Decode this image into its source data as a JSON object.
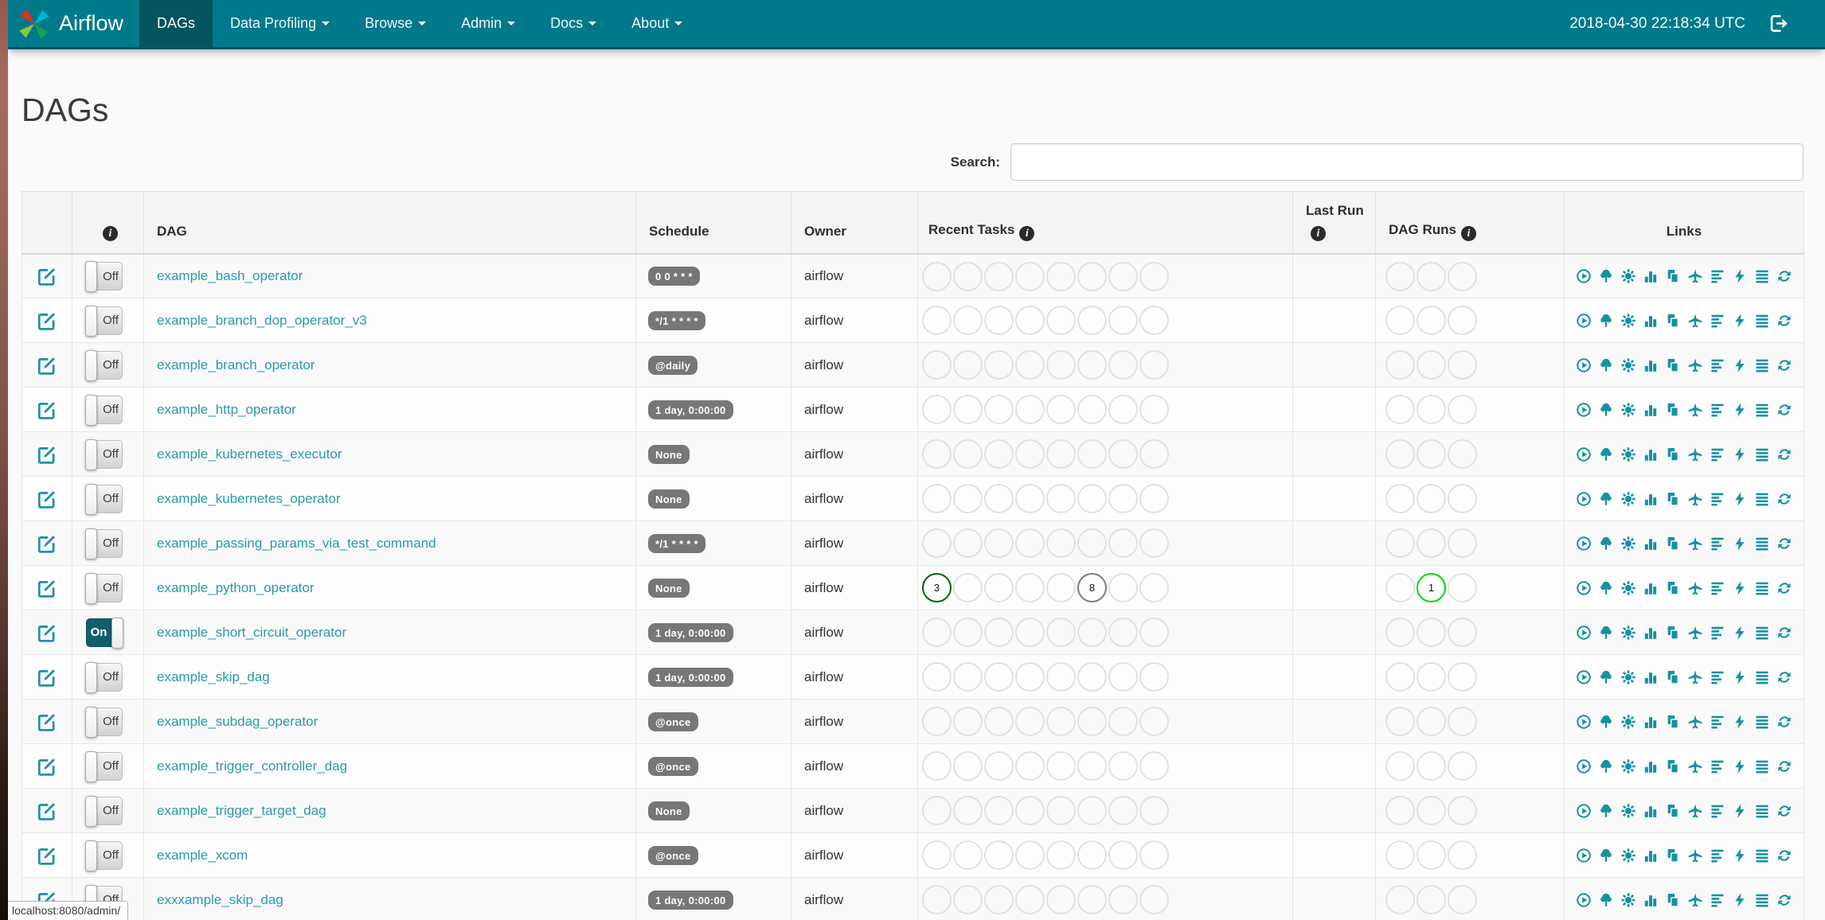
{
  "colors": {
    "navbar": "#00798a",
    "navbar_active": "#03545e",
    "link": "#2c9aa7",
    "icon": "#1691a3",
    "badge_bg": "#777777",
    "state_success": "#006400",
    "state_running": "#00d800",
    "state_queued": "#7d7d7d",
    "state_empty": "#e2e2e2"
  },
  "navbar": {
    "brand": "Airflow",
    "items": [
      {
        "label": "DAGs",
        "active": true
      },
      {
        "label": "Data Profiling"
      },
      {
        "label": "Browse"
      },
      {
        "label": "Admin"
      },
      {
        "label": "Docs"
      },
      {
        "label": "About"
      }
    ],
    "clock": "2018-04-30 22:18:34 UTC"
  },
  "page": {
    "title": "DAGs"
  },
  "search": {
    "label": "Search:",
    "value": "",
    "placeholder": ""
  },
  "table": {
    "headers": [
      {
        "label": ""
      },
      {
        "label": "",
        "info": true
      },
      {
        "label": "DAG"
      },
      {
        "label": "Schedule"
      },
      {
        "label": "Owner"
      },
      {
        "label": "Recent Tasks",
        "info": true
      },
      {
        "label": "Last Run",
        "info": true
      },
      {
        "label": "DAG Runs",
        "info": true
      },
      {
        "label": "Links"
      }
    ],
    "recent_task_circle_count": 8,
    "dag_run_circle_count": 3
  },
  "toggle": {
    "on_label": "On",
    "off_label": "Off"
  },
  "links": [
    "Trigger Dag",
    "Tree View",
    "Graph View",
    "Task Duration",
    "Task Tries",
    "Landing Times",
    "Gantt View",
    "Code View",
    "Logs",
    "Refresh"
  ],
  "link_icons": [
    "play-circle-icon",
    "tree-icon",
    "graph-icon",
    "duration-chart-icon",
    "task-tries-icon",
    "landing-times-icon",
    "gantt-icon",
    "code-bolt-icon",
    "logs-icon",
    "refresh-icon"
  ],
  "rows": [
    {
      "dag": "example_bash_operator",
      "toggle": "off",
      "schedule": "0 0 * * *",
      "owner": "airflow"
    },
    {
      "dag": "example_branch_dop_operator_v3",
      "toggle": "off",
      "schedule": "*/1 * * * *",
      "owner": "airflow"
    },
    {
      "dag": "example_branch_operator",
      "toggle": "off",
      "schedule": "@daily",
      "owner": "airflow"
    },
    {
      "dag": "example_http_operator",
      "toggle": "off",
      "schedule": "1 day, 0:00:00",
      "owner": "airflow"
    },
    {
      "dag": "example_kubernetes_executor",
      "toggle": "off",
      "schedule": "None",
      "owner": "airflow"
    },
    {
      "dag": "example_kubernetes_operator",
      "toggle": "off",
      "schedule": "None",
      "owner": "airflow"
    },
    {
      "dag": "example_passing_params_via_test_command",
      "toggle": "off",
      "schedule": "*/1 * * * *",
      "owner": "airflow"
    },
    {
      "dag": "example_python_operator",
      "toggle": "off",
      "schedule": "None",
      "owner": "airflow",
      "recent_tasks": [
        {
          "index": 0,
          "count": "3",
          "state": "success"
        },
        {
          "index": 5,
          "count": "8",
          "state": "queued"
        }
      ],
      "dag_runs": [
        {
          "index": 1,
          "count": "1",
          "state": "running"
        }
      ]
    },
    {
      "dag": "example_short_circuit_operator",
      "toggle": "on",
      "schedule": "1 day, 0:00:00",
      "owner": "airflow"
    },
    {
      "dag": "example_skip_dag",
      "toggle": "off",
      "schedule": "1 day, 0:00:00",
      "owner": "airflow"
    },
    {
      "dag": "example_subdag_operator",
      "toggle": "off",
      "schedule": "@once",
      "owner": "airflow"
    },
    {
      "dag": "example_trigger_controller_dag",
      "toggle": "off",
      "schedule": "@once",
      "owner": "airflow"
    },
    {
      "dag": "example_trigger_target_dag",
      "toggle": "off",
      "schedule": "None",
      "owner": "airflow"
    },
    {
      "dag": "example_xcom",
      "toggle": "off",
      "schedule": "@once",
      "owner": "airflow"
    },
    {
      "dag": "exxxample_skip_dag",
      "toggle": "off",
      "schedule": "1 day, 0:00:00",
      "owner": "airflow"
    }
  ],
  "status_bar": "localhost:8080/admin/"
}
